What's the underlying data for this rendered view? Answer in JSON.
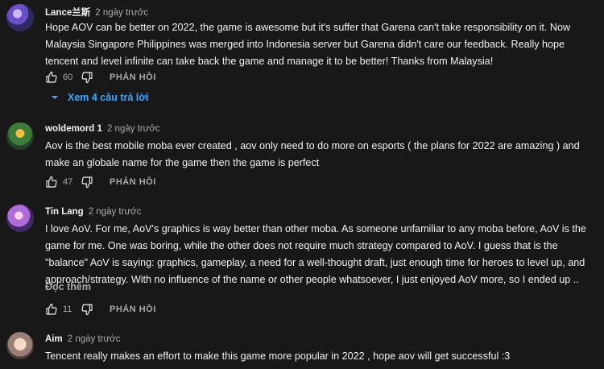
{
  "comments": [
    {
      "author": "Lance兰斯",
      "time": "2 ngày trước",
      "text": "Hope AOV can be better on 2022, the game is awesome but it's suffer that Garena can't take responsibility on it. Now Malaysia Singapore Philippines was merged into Indonesia server but Garena didn't care our feedback. Really hope tencent and level infinite can take back the game and manage it to be better! Thanks from Malaysia!",
      "likes": "60",
      "reply_label": "PHẢN HỒI",
      "view_replies": "Xem 4 câu trả lời"
    },
    {
      "author": "woldemord 1",
      "time": "2 ngày trước",
      "text": "Aov is the best mobile moba ever created , aov only need to do more on esports ( the plans for 2022 are amazing ) and make an globale name for the game then the game is perfect",
      "likes": "47",
      "reply_label": "PHẢN HỒI"
    },
    {
      "author": "Tin Lang",
      "time": "2 ngày trước",
      "text": "I love AoV. For me, AoV's graphics is way better than other moba. As someone unfamiliar to any moba before, AoV is the game for me. One was boring, while the other does not require much strategy compared to AoV. I guess that is the \"balance\" AoV is saying: graphics, gameplay, a need for a well-thought draft, just enough time for heroes to level up, and approach/strategy. With no influence of the name or other people whatsoever, I just enjoyed AoV more, so I ended up ..",
      "read_more": "Đọc thêm",
      "likes": "11",
      "reply_label": "PHẢN HỒI"
    },
    {
      "author": "Aim",
      "time": "2 ngày trước",
      "text": "Tencent really makes an effort to make this game more popular in 2022 , hope aov will get successful :3"
    }
  ]
}
